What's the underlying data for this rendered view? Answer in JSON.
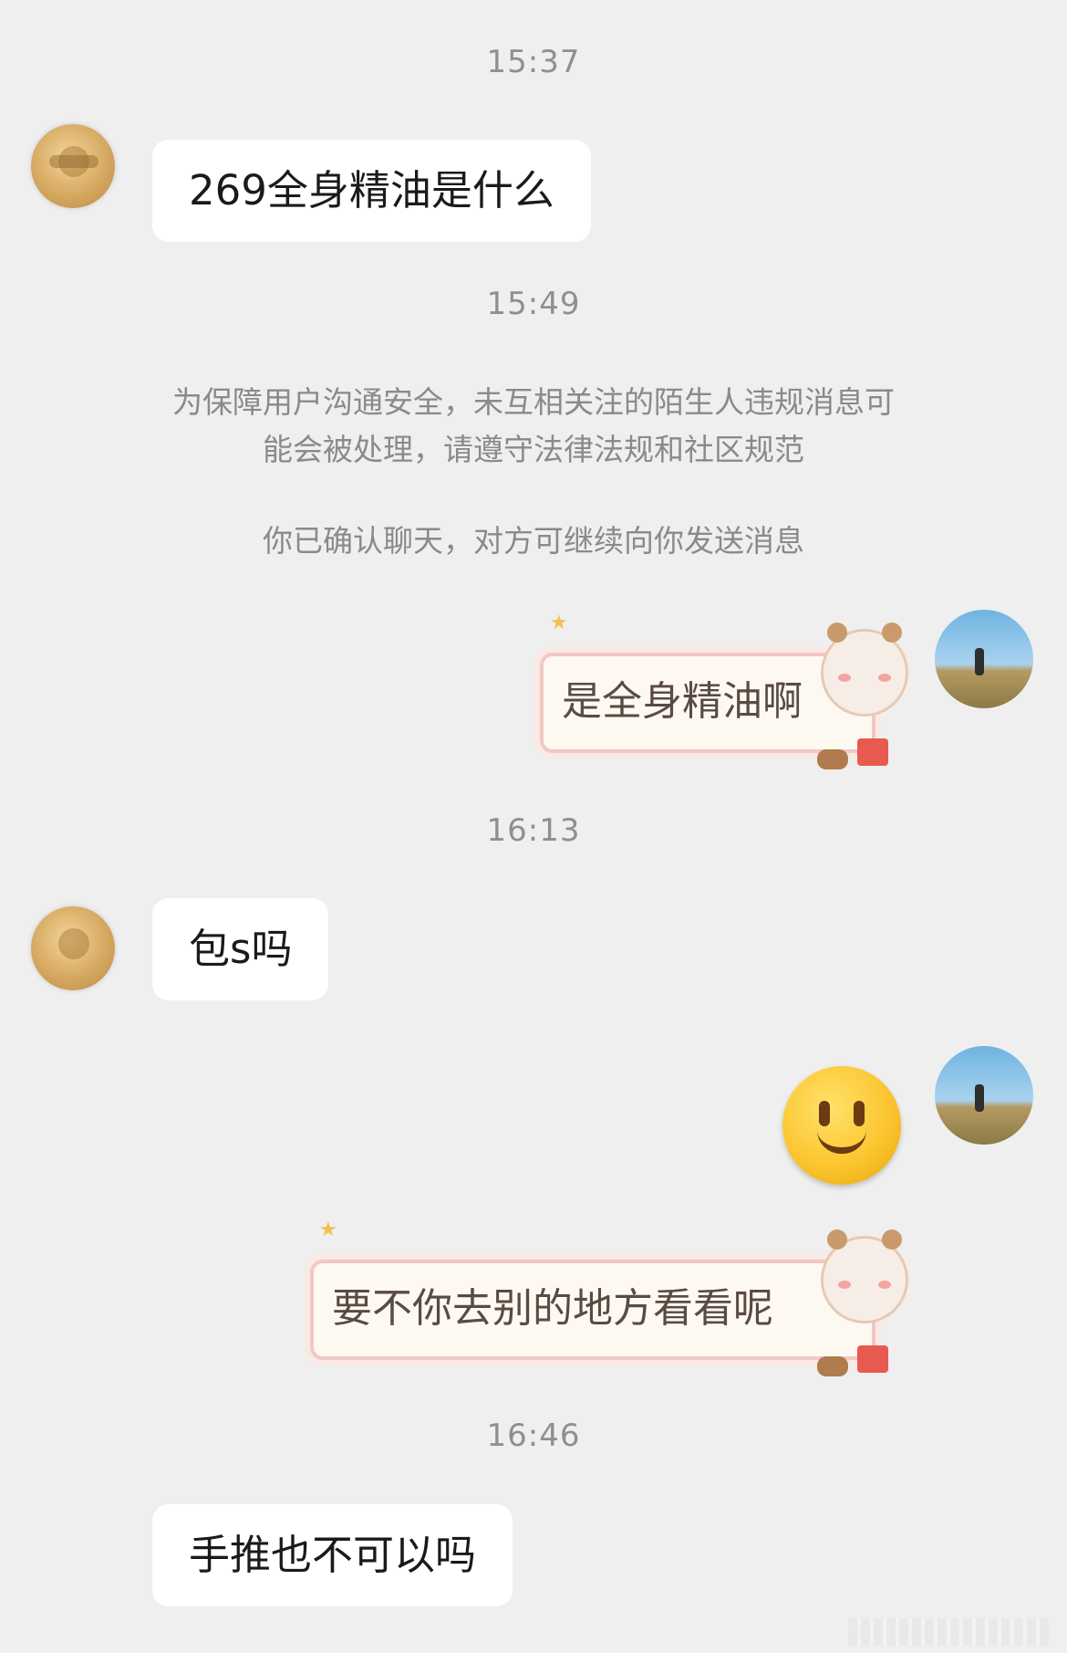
{
  "chat": {
    "timestamps": [
      "15:37",
      "15:49",
      "16:13",
      "16:46"
    ],
    "notice_line1": "为保障用户沟通安全，未互相关注的陌生人违规消息可",
    "notice_line2": "能会被处理，请遵守法律法规和社区规范",
    "confirm_notice": "你已确认聊天，对方可继续向你发送消息",
    "messages": [
      {
        "sender": "other",
        "type": "text",
        "text": "269全身精油是什么"
      },
      {
        "sender": "me",
        "type": "sticker",
        "text": "是全身精油啊"
      },
      {
        "sender": "other",
        "type": "text",
        "text": "包s吗"
      },
      {
        "sender": "me",
        "type": "emoji",
        "icon": "slightly-smiling-face-emoji"
      },
      {
        "sender": "me",
        "type": "sticker",
        "text": "要不你去别的地方看看呢"
      },
      {
        "sender": "other",
        "type": "text",
        "text": "手推也不可以吗"
      }
    ]
  },
  "colors": {
    "background": "#efefef",
    "incoming_bubble": "#ffffff",
    "timestamp_text": "#8f8f8f",
    "sticker_border": "#f1c8c4"
  }
}
